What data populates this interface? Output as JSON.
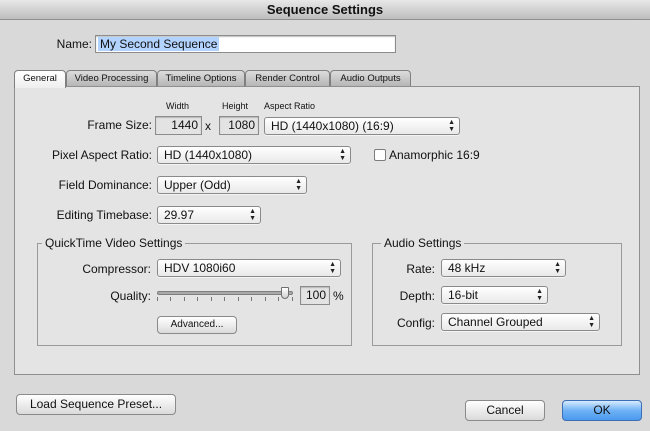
{
  "window": {
    "title": "Sequence Settings"
  },
  "name_field": {
    "label": "Name:",
    "value": "My Second Sequence"
  },
  "tabs": [
    {
      "label": "General",
      "active": true
    },
    {
      "label": "Video Processing",
      "active": false
    },
    {
      "label": "Timeline Options",
      "active": false
    },
    {
      "label": "Render Control",
      "active": false
    },
    {
      "label": "Audio Outputs",
      "active": false
    }
  ],
  "general": {
    "frame_size": {
      "label": "Frame Size:",
      "width_label": "Width",
      "height_label": "Height",
      "aspect_ratio_label": "Aspect Ratio",
      "width": "1440",
      "separator": "x",
      "height": "1080",
      "aspect_ratio": "HD (1440x1080) (16:9)"
    },
    "pixel_aspect_ratio": {
      "label": "Pixel Aspect Ratio:",
      "value": "HD (1440x1080)"
    },
    "anamorphic": {
      "label": "Anamorphic 16:9",
      "checked": false
    },
    "field_dominance": {
      "label": "Field Dominance:",
      "value": "Upper (Odd)"
    },
    "editing_timebase": {
      "label": "Editing Timebase:",
      "value": "29.97"
    }
  },
  "quicktime": {
    "title": "QuickTime Video Settings",
    "compressor": {
      "label": "Compressor:",
      "value": "HDV 1080i60"
    },
    "quality": {
      "label": "Quality:",
      "value": "100",
      "unit": "%",
      "level": 1.0
    },
    "advanced_button": "Advanced..."
  },
  "audio": {
    "title": "Audio Settings",
    "rate": {
      "label": "Rate:",
      "value": "48 kHz"
    },
    "depth": {
      "label": "Depth:",
      "value": "16-bit"
    },
    "config": {
      "label": "Config:",
      "value": "Channel Grouped"
    }
  },
  "footer": {
    "load_preset": "Load Sequence Preset...",
    "cancel": "Cancel",
    "ok": "OK"
  },
  "icons": {
    "popup_arrows": "popup-arrows-icon",
    "slider_thumb": "slider-thumb-icon"
  },
  "colors": {
    "ok_button": "#4b99ee",
    "selection": "#b3d3ff",
    "dialog_bg": "#d9d9d9"
  }
}
